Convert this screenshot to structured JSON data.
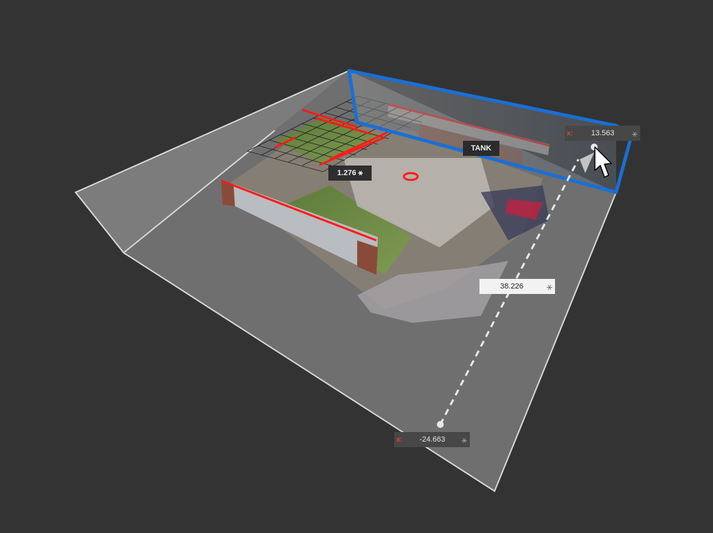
{
  "viewport": {
    "label_tank": "TANK",
    "height_value": "1.276",
    "x_top": {
      "axis": "x:",
      "value": "13.563"
    },
    "x_bottom": {
      "axis": "x:",
      "value": "-24.663"
    },
    "distance_value": "38.226",
    "snap_symbol": "⚹"
  },
  "colors": {
    "background": "#333333",
    "floor": "#6f6f6f",
    "edge": "#d8d8d8",
    "highlight_plane": "#1a6fd4",
    "feature_lines": "#ff1a1a",
    "axis_label": "#e04040"
  },
  "icons": {
    "cursor": "arrow-cursor-icon",
    "snap": "snap-asterisk-icon"
  }
}
